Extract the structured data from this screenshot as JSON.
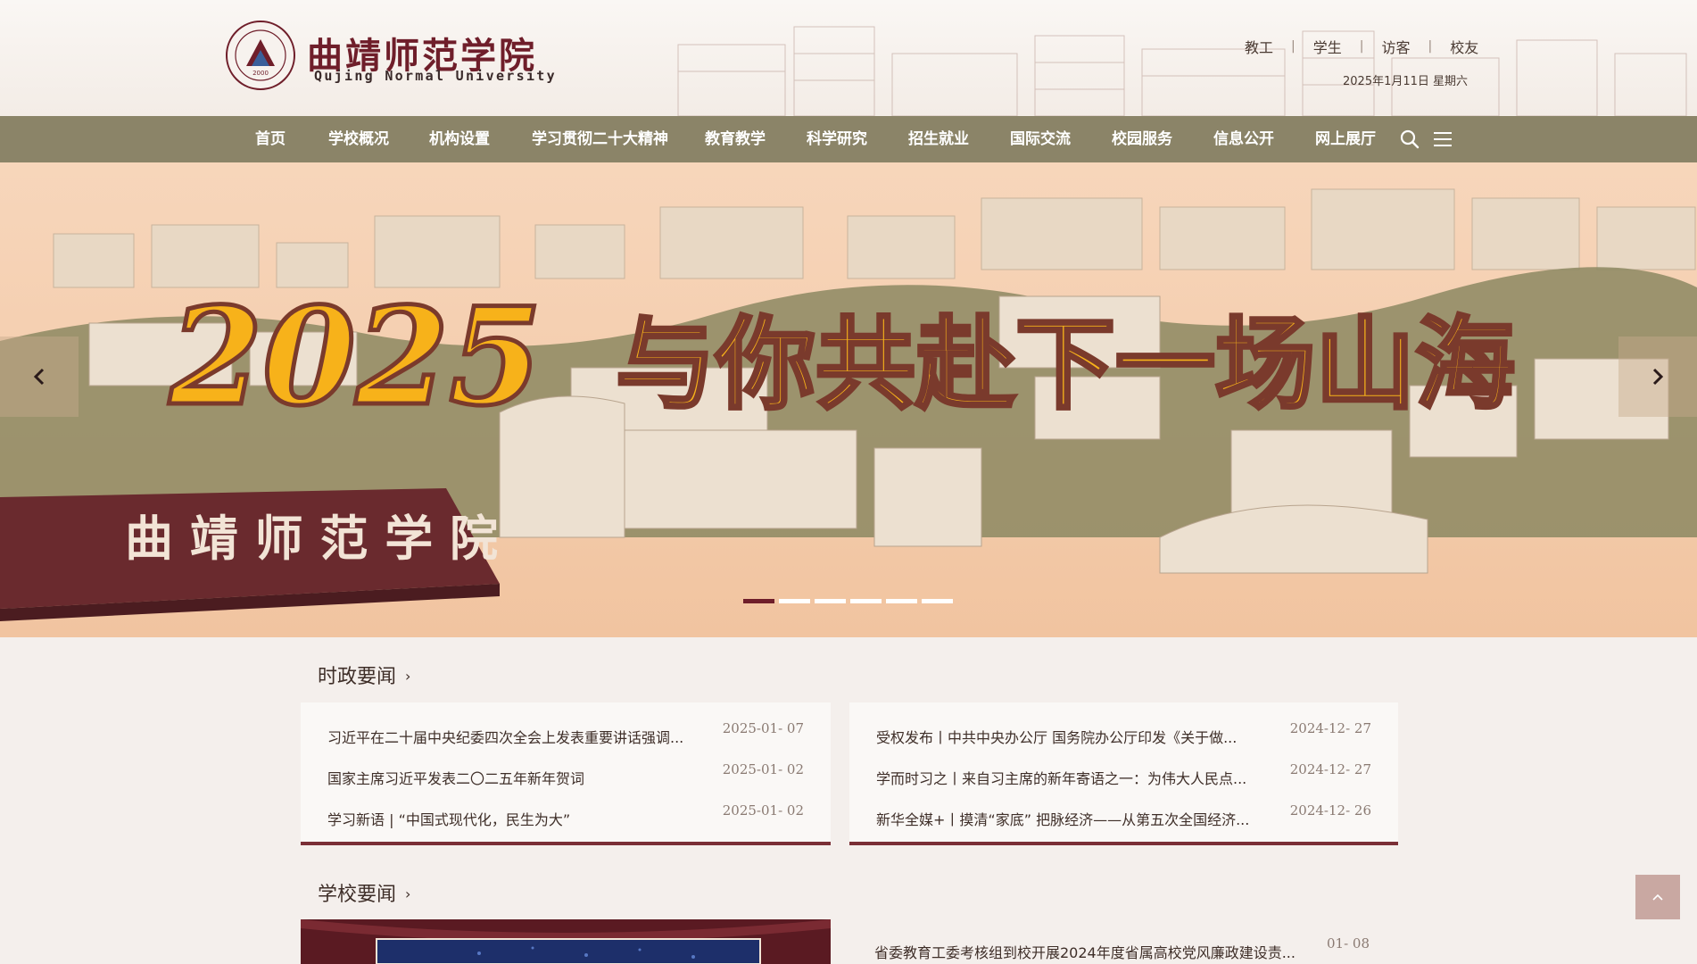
{
  "header": {
    "logo_cn": "曲靖师范学院",
    "logo_en": "Qujing Normal University",
    "seal_text": "2000",
    "user_links": [
      "教工",
      "学生",
      "访客",
      "校友"
    ],
    "date": "2025年1月11日 星期六"
  },
  "nav": {
    "items": [
      "首页",
      "学校概况",
      "机构设置",
      "学习贯彻二十大精神",
      "教育教学",
      "科学研究",
      "招生就业",
      "国际交流",
      "校园服务",
      "信息公开",
      "网上展厅"
    ],
    "search_icon": "search-icon",
    "menu_icon": "menu-icon"
  },
  "banner": {
    "headline_year": "2025",
    "headline_text": "与你共赴下一场山海",
    "plaque_text": "曲 靖 师 范 学 院",
    "slide_count": 6,
    "active_slide": 1
  },
  "policy_news": {
    "title": "时政要闻",
    "left": [
      {
        "title": "习近平在二十届中央纪委四次全会上发表重要讲话强调...",
        "date": "2025-01- 07"
      },
      {
        "title": "国家主席习近平发表二〇二五年新年贺词",
        "date": "2025-01- 02"
      },
      {
        "title": "学习新语 | “中国式现代化，民生为大”",
        "date": "2025-01- 02"
      }
    ],
    "right": [
      {
        "title": "受权发布丨中共中央办公厅 国务院办公厅印发《关于做...",
        "date": "2024-12- 27"
      },
      {
        "title": "学而时习之丨来自习主席的新年寄语之一：为伟大人民点...",
        "date": "2024-12- 27"
      },
      {
        "title": "新华全媒+丨摸清“家底” 把脉经济——从第五次全国经济...",
        "date": "2024-12- 26"
      }
    ]
  },
  "campus_news": {
    "title": "学校要闻",
    "items": [
      {
        "title": "省委教育工委考核组到校开展2024年度省属高校党风廉政建设责...",
        "date": "01- 08"
      }
    ]
  },
  "colors": {
    "nav_bg": "#8b8468",
    "brand": "#6f1e2a",
    "banner_bg": "#f4cba9",
    "headline": "#f7b21a"
  }
}
